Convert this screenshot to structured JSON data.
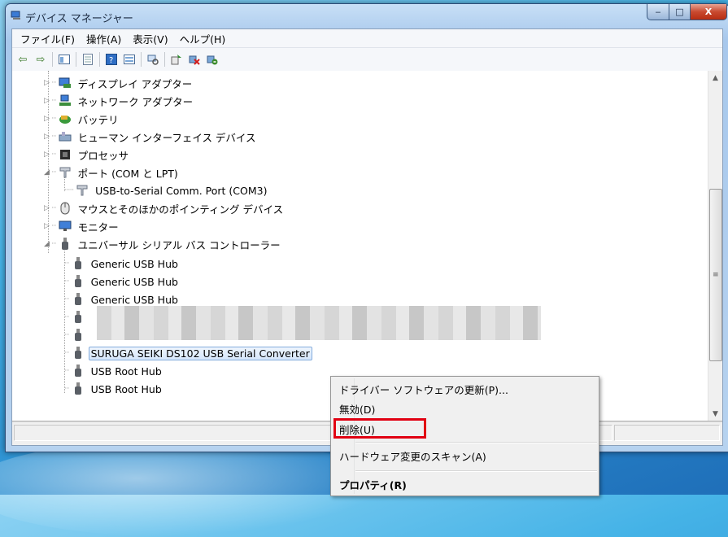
{
  "window": {
    "title": "デバイス マネージャー",
    "caption": {
      "minimize": "‒",
      "maximize": "□",
      "close": "X"
    }
  },
  "menubar": [
    "ファイル(F)",
    "操作(A)",
    "表示(V)",
    "ヘルプ(H)"
  ],
  "toolbar": [
    "back-icon",
    "forward-icon",
    "console-tree-icon",
    "properties-icon",
    "help-icon",
    "view-icon",
    "scan-icon",
    "update-driver-icon",
    "disable-device-icon",
    "uninstall-icon"
  ],
  "tree": {
    "display_adapters": "ディスプレイ アダプター",
    "network_adapters": "ネットワーク アダプター",
    "batteries": "バッテリ",
    "hid": "ヒューマン インターフェイス デバイス",
    "processors": "プロセッサ",
    "ports": "ポート (COM と LPT)",
    "com3": "USB-to-Serial Comm. Port (COM3)",
    "mice": "マウスとそのほかのポインティング デバイス",
    "monitors": "モニター",
    "usb": "ユニバーサル シリアル バス コントローラー",
    "usb_children": [
      "Generic USB Hub",
      "Generic USB Hub",
      "Generic USB Hub",
      "",
      "",
      "SURUGA SEIKI DS102 USB Serial Converter",
      "USB Root Hub",
      "USB Root Hub"
    ]
  },
  "context_menu": {
    "update": "ドライバー ソフトウェアの更新(P)...",
    "disable": "無効(D)",
    "uninstall": "削除(U)",
    "scan": "ハードウェア変更のスキャン(A)",
    "properties": "プロパティ(R)"
  },
  "colors": {
    "highlight": "#e10012",
    "selection": "#d6e7fb"
  }
}
